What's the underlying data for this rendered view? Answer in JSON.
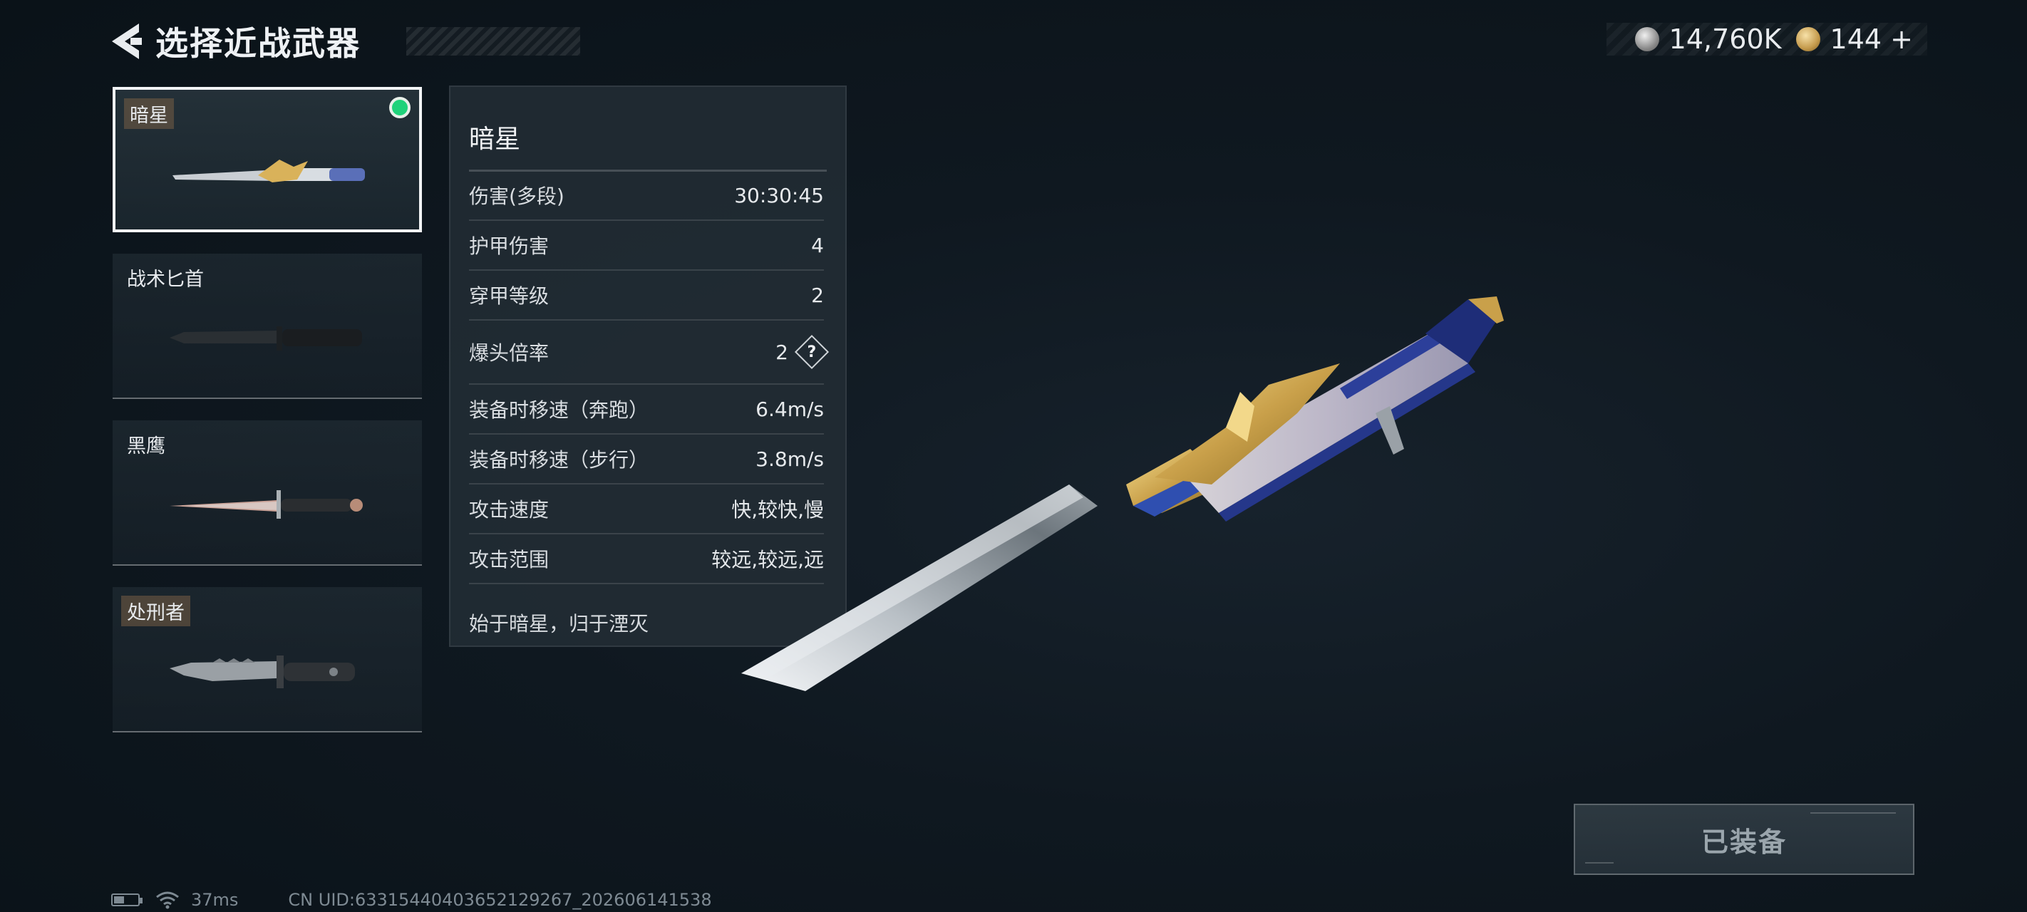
{
  "header": {
    "title": "选择近战武器"
  },
  "currency": {
    "silver": {
      "value": "14,760K",
      "icon": "silver-coin-icon"
    },
    "gold": {
      "value": "144 +",
      "icon": "gold-coin-icon"
    }
  },
  "weapons": [
    {
      "name": "暗星",
      "selected": true,
      "equipped": true,
      "icon": "star-dagger-icon"
    },
    {
      "name": "战术匕首",
      "selected": false,
      "equipped": false,
      "icon": "tactical-knife-icon"
    },
    {
      "name": "黑鹰",
      "selected": false,
      "equipped": false,
      "icon": "black-hawk-knife-icon"
    },
    {
      "name": "处刑者",
      "selected": false,
      "equipped": false,
      "icon": "executioner-knife-icon"
    }
  ],
  "stats": {
    "name": "暗星",
    "rows": [
      {
        "label": "伤害(多段)",
        "value": "30:30:45"
      },
      {
        "label": "护甲伤害",
        "value": "4"
      },
      {
        "label": "穿甲等级",
        "value": "2"
      },
      {
        "label": "爆头倍率",
        "value": "2",
        "help": "?"
      },
      {
        "label": "装备时移速（奔跑）",
        "value": "6.4m/s"
      },
      {
        "label": "装备时移速（步行）",
        "value": "3.8m/s"
      },
      {
        "label": "攻击速度",
        "value": "快,较快,慢"
      },
      {
        "label": "攻击范围",
        "value": "较远,较远,远"
      }
    ],
    "flavor": "始于暗星，归于湮灭"
  },
  "actions": {
    "equip_label": "已装备"
  },
  "footer": {
    "ping": "37ms",
    "uid": "CN UID:63315440403652129267_202606141538"
  },
  "colors": {
    "equipped_indicator": "#1fd27a",
    "background": "#0f1820"
  }
}
